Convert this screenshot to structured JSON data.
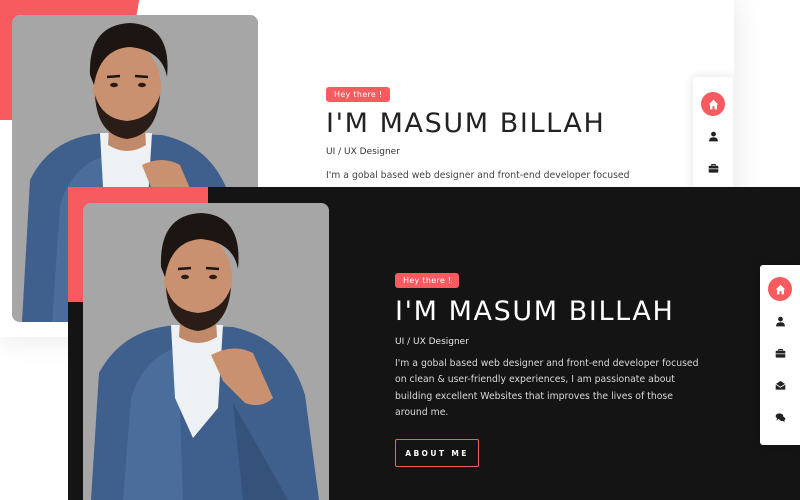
{
  "hero": {
    "badge": "Hey there !",
    "name": "I'M MASUM BILLAH",
    "role": "UI / UX Designer",
    "description": "I'm a gobal based web designer and front-end developer focused on clean & user-friendly experiences, I am passionate about building excellent Websites that improves the lives of those around me.",
    "description_truncated": "I'm a gobal based web designer and front-end developer focused on clean & user-friendly experiences, I am passionate about building",
    "button_label": "ABOUT ME"
  },
  "nav": {
    "items": [
      {
        "icon": "home-icon",
        "active": true
      },
      {
        "icon": "user-icon",
        "active": false
      },
      {
        "icon": "briefcase-icon",
        "active": false
      },
      {
        "icon": "envelope-icon",
        "active": false
      },
      {
        "icon": "chat-icon",
        "active": false
      }
    ]
  },
  "colors": {
    "accent": "#f75a5f",
    "dark_bg": "#141414",
    "light_bg": "#ffffff"
  }
}
